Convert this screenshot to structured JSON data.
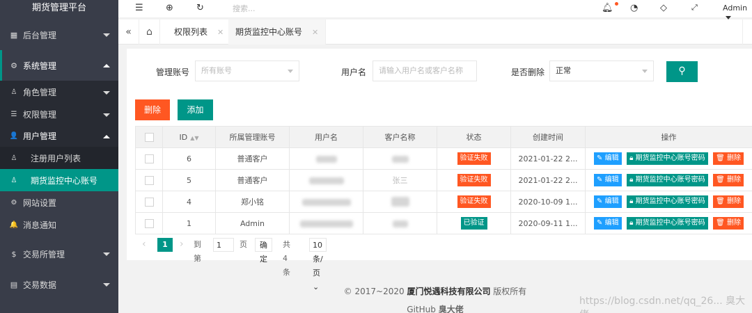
{
  "sidebar": {
    "title": "期货管理平台",
    "items": [
      {
        "label": "后台管理"
      },
      {
        "label": "系统管理"
      },
      {
        "label": "角色管理"
      },
      {
        "label": "权限管理"
      },
      {
        "label": "用户管理"
      },
      {
        "label": "注册用户列表"
      },
      {
        "label": "期货监控中心账号"
      },
      {
        "label": "网站设置"
      },
      {
        "label": "消息通知"
      },
      {
        "label": "交易所管理"
      },
      {
        "label": "交易数据"
      }
    ]
  },
  "header": {
    "search_placeholder": "搜索...",
    "user": "Admin"
  },
  "tabs": [
    {
      "label": "权限列表"
    },
    {
      "label": "期货监控中心账号"
    }
  ],
  "filters": {
    "account_label": "管理账号",
    "account_value": "所有账号",
    "username_label": "用户名",
    "username_placeholder": "请输入用户名或客户名称",
    "deleted_label": "是否删除",
    "deleted_value": "正常"
  },
  "buttons": {
    "delete": "删除",
    "add": "添加"
  },
  "table": {
    "headers": [
      "ID",
      "所属管理账号",
      "用户名",
      "客户名称",
      "状态",
      "创建时间",
      "操作"
    ],
    "rows": [
      {
        "id": "6",
        "account": "普通客户",
        "customer": "",
        "status": "验证失败",
        "status_type": "fail",
        "created": "2021-01-22 2..."
      },
      {
        "id": "5",
        "account": "普通客户",
        "customer": "张三",
        "status": "验证失败",
        "status_type": "fail",
        "created": "2021-01-22 2..."
      },
      {
        "id": "4",
        "account": "郑小铭",
        "customer": "",
        "status": "验证失败",
        "status_type": "fail",
        "created": "2020-10-09 1..."
      },
      {
        "id": "1",
        "account": "Admin",
        "customer": "",
        "status": "已验证",
        "status_type": "ok",
        "created": "2020-09-11 1..."
      }
    ],
    "actions": {
      "edit": "编辑",
      "password": "期货监控中心账号密码",
      "delete": "删除"
    }
  },
  "pager": {
    "current": "1",
    "goto_label": "到第",
    "goto_value": "1",
    "page_label": "页",
    "confirm": "确定",
    "total": "共 4 条",
    "per_page": "10 条/页"
  },
  "footer": {
    "copyright": "© 2017~2020",
    "company": "厦门悦遇科技有限公司",
    "rights": "版权所有",
    "github": "GitHub",
    "author": "臭大佬"
  },
  "watermark": "https://blog.csdn.net/qq_26... 臭大佬",
  "colors": {
    "accent": "#009688",
    "danger": "#ff5722",
    "info": "#1e9fff",
    "sidebar": "#393d49"
  }
}
